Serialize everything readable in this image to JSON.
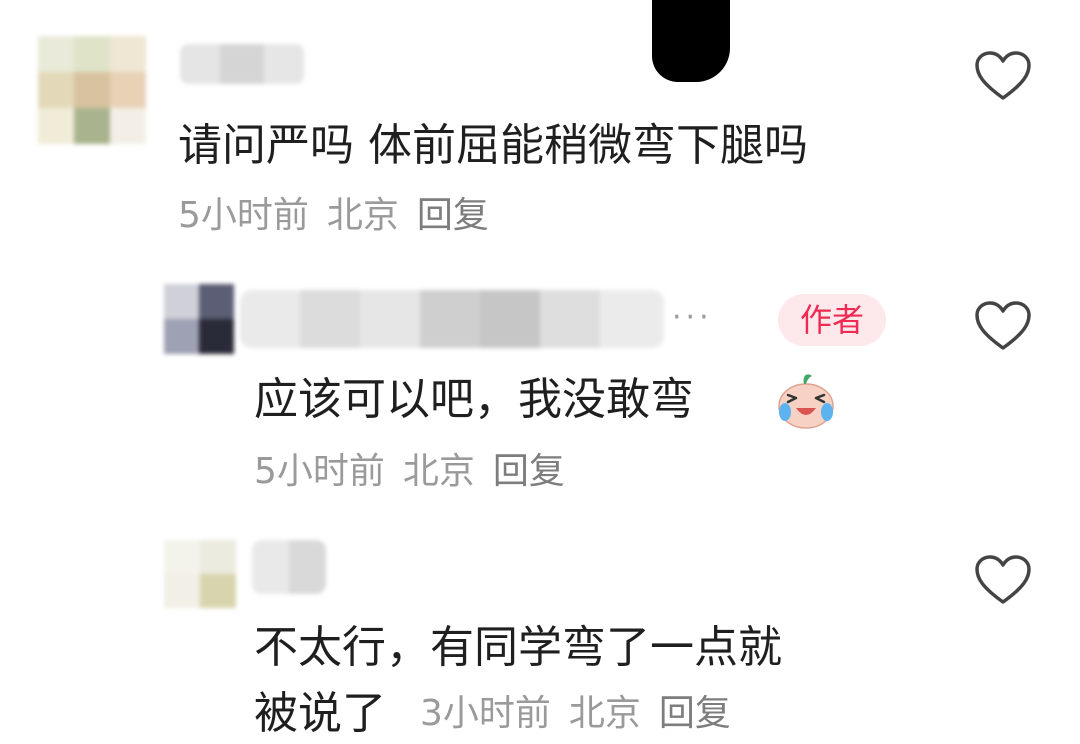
{
  "comments": [
    {
      "text": "请问严吗 体前屈能稍微弯下腿吗",
      "time": "5小时前",
      "location": "北京",
      "reply": "回复"
    },
    {
      "text": "应该可以吧，我没敢弯",
      "badge": "作者",
      "ellipsis": "···",
      "emoji": "crying-laughing-face",
      "time": "5小时前",
      "location": "北京",
      "reply": "回复"
    },
    {
      "text_line1": "不太行，有同学弯了一点就",
      "text_line2": "被说了",
      "time": "3小时前",
      "location": "北京",
      "reply": "回复"
    }
  ],
  "colors": {
    "badge_text": "#ef2b53",
    "badge_bg": "#fde8ec",
    "meta": "#9a9a9a"
  }
}
